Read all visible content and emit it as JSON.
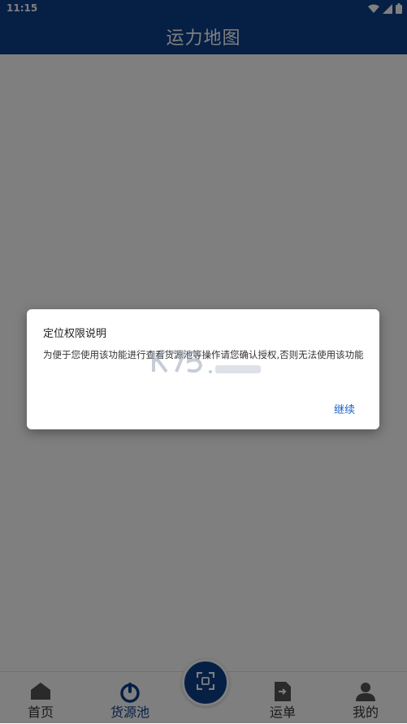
{
  "status_bar": {
    "time": "11:15"
  },
  "header": {
    "title": "运力地图"
  },
  "bottom_nav": {
    "items": [
      {
        "label": "首页"
      },
      {
        "label": "货源池"
      },
      {
        "label": "运单"
      },
      {
        "label": "我的"
      }
    ]
  },
  "dialog": {
    "title": "定位权限说明",
    "message": "为便于您使用该功能进行查看货源池等操作请您确认授权,否则无法使用该功能",
    "continue_label": "继续"
  },
  "colors": {
    "primary": "#0d3f8a",
    "link": "#1a63c9",
    "overlay": "rgba(0,0,0,0.5)"
  }
}
